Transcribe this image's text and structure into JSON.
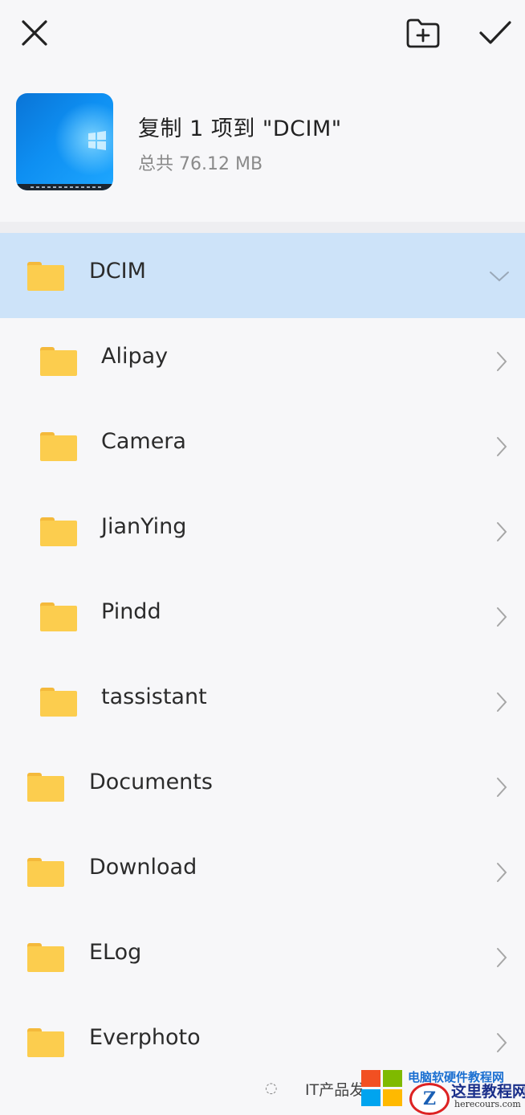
{
  "header": {
    "close_icon": "close-icon",
    "new_folder_icon": "new-folder-icon",
    "confirm_icon": "check-icon"
  },
  "summary": {
    "title": "复制 1 项到 \"DCIM\"",
    "subtitle": "总共 76.12 MB"
  },
  "folders": [
    {
      "name": "DCIM",
      "depth": 0,
      "expanded": true
    },
    {
      "name": "Alipay",
      "depth": 1
    },
    {
      "name": "Camera",
      "depth": 1
    },
    {
      "name": "JianYing",
      "depth": 1
    },
    {
      "name": "Pindd",
      "depth": 1
    },
    {
      "name": "tassistant",
      "depth": 1
    },
    {
      "name": "Documents",
      "depth": 0
    },
    {
      "name": "Download",
      "depth": 0
    },
    {
      "name": "ELog",
      "depth": 0
    },
    {
      "name": "Everphoto",
      "depth": 0
    }
  ],
  "colors": {
    "accent_highlight": "#cde3f9",
    "folder_yellow": "#fccd4e"
  },
  "watermark": {
    "left_text": "IT产品发",
    "site_cn_top": "电脑软硬件教程网",
    "brand": "这里教程网",
    "url": "herecours.com"
  }
}
